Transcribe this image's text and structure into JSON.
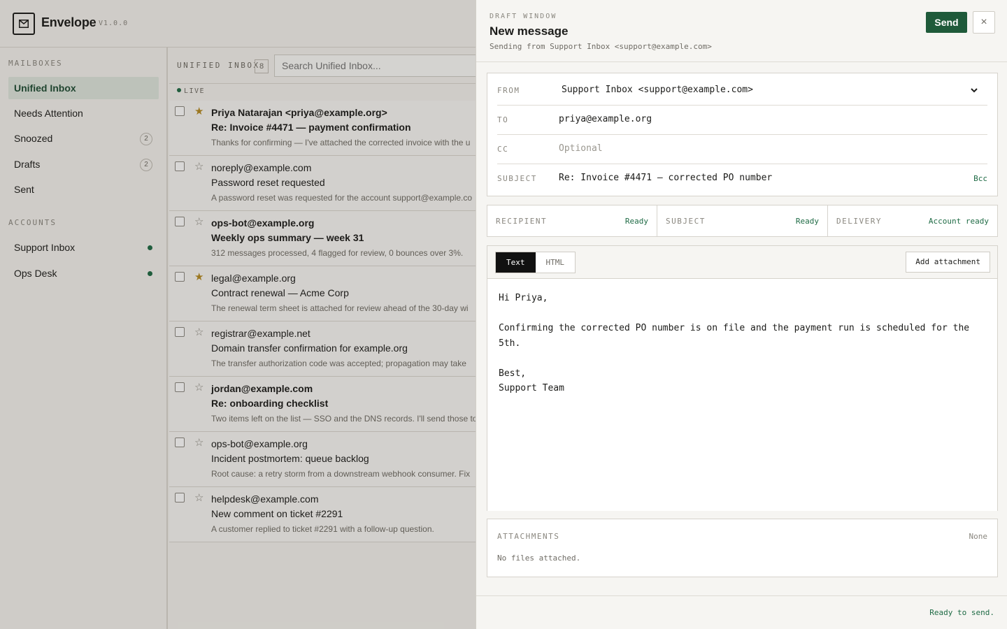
{
  "app": {
    "name": "Envelope",
    "version": "V1.0.0"
  },
  "sidebar": {
    "mailboxes_heading": "MAILBOXES",
    "mailboxes": [
      {
        "label": "Unified Inbox",
        "active": true
      },
      {
        "label": "Needs Attention"
      },
      {
        "label": "Snoozed",
        "count": "2"
      },
      {
        "label": "Drafts",
        "count": "2"
      },
      {
        "label": "Sent"
      }
    ],
    "accounts_heading": "ACCOUNTS",
    "accounts": [
      {
        "label": "Support Inbox",
        "status_color": "#1f6b45"
      },
      {
        "label": "Ops Desk",
        "status_color": "#1f6b45"
      }
    ]
  },
  "list": {
    "title": "UNIFIED INBOX",
    "count": "8",
    "search_placeholder": "Search Unified Inbox...",
    "live_label": "LIVE",
    "messages": [
      {
        "from": "Priya Natarajan <priya@example.org>",
        "subject": "Re: Invoice #4471 — payment confirmation",
        "preview": "Thanks for confirming — I've attached the corrected invoice with the u",
        "starred": true,
        "unread": true
      },
      {
        "from": "noreply@example.com",
        "subject": "Password reset requested",
        "preview": "A password reset was requested for the account support@example.co",
        "starred": false,
        "unread": false
      },
      {
        "from": "ops-bot@example.org",
        "subject": "Weekly ops summary — week 31",
        "preview": "312 messages processed, 4 flagged for review, 0 bounces over 3%.",
        "starred": false,
        "unread": true
      },
      {
        "from": "legal@example.org",
        "subject": "Contract renewal — Acme Corp",
        "preview": "The renewal term sheet is attached for review ahead of the 30-day wi",
        "starred": true,
        "unread": false
      },
      {
        "from": "registrar@example.net",
        "subject": "Domain transfer confirmation for example.org",
        "preview": "The transfer authorization code was accepted; propagation may take",
        "starred": false,
        "unread": false
      },
      {
        "from": "jordan@example.com",
        "subject": "Re: onboarding checklist",
        "preview": "Two items left on the list — SSO and the DNS records. I'll send those to",
        "starred": false,
        "unread": true
      },
      {
        "from": "ops-bot@example.org",
        "subject": "Incident postmortem: queue backlog",
        "preview": "Root cause: a retry storm from a downstream webhook consumer. Fix",
        "starred": false,
        "unread": false
      },
      {
        "from": "helpdesk@example.com",
        "subject": "New comment on ticket #2291",
        "preview": "A customer replied to ticket #2291 with a follow-up question.",
        "starred": false,
        "unread": false
      }
    ]
  },
  "draft": {
    "kicker": "DRAFT WINDOW",
    "title": "New message",
    "subtitle": "Sending from Support Inbox <support@example.com>",
    "send_label": "Send",
    "close_label": "×",
    "from_label": "FROM",
    "from_value": "Support Inbox <support@example.com>",
    "to_label": "TO",
    "to_value": "priya@example.org",
    "cc_label": "CC",
    "cc_placeholder": "Optional",
    "subject_label": "SUBJECT",
    "subject_value": "Re: Invoice #4471 — corrected PO number",
    "bcc_label": "Bcc",
    "checks": [
      {
        "label": "RECIPIENT",
        "value": "Ready"
      },
      {
        "label": "SUBJECT",
        "value": "Ready"
      },
      {
        "label": "DELIVERY",
        "value": "Account ready"
      }
    ],
    "format_tabs": [
      "Text",
      "HTML"
    ],
    "active_format": "Text",
    "add_attachment_label": "Add attachment",
    "body": "Hi Priya,\n\nConfirming the corrected PO number is on file and the payment run is scheduled for the\n5th.\n\nBest,\nSupport Team",
    "attachments_label": "ATTACHMENTS",
    "attachments_count": "None",
    "attachments_empty": "No files attached.",
    "footer_status": "Ready to send.",
    "accent_color": "#1f5a3a"
  }
}
